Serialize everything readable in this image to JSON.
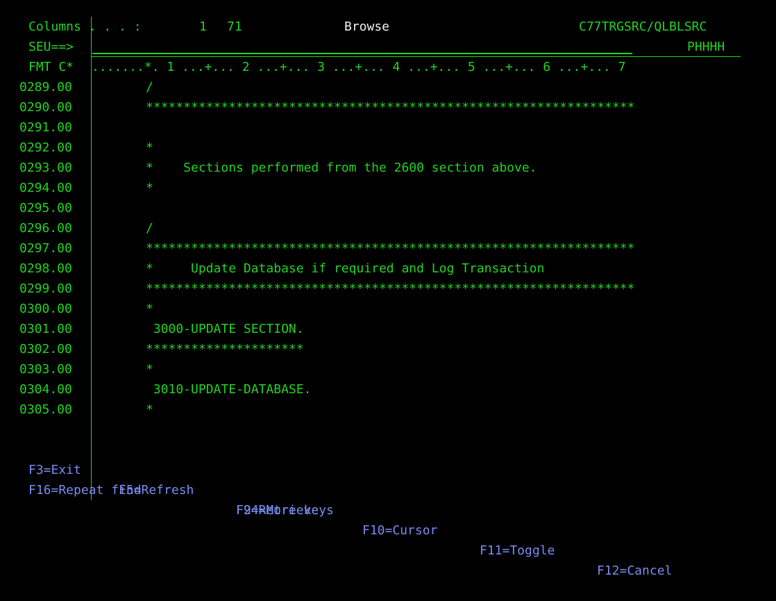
{
  "header": {
    "columns_label": "Columns . . . :",
    "columns_from": "1",
    "columns_to": "71",
    "mode": "Browse",
    "source_member": "C77TRGSRC/QLBLSRC",
    "command_prompt": "SEU==>",
    "command_value": "",
    "member_name": "PHHHH"
  },
  "ruler": {
    "prefix_label": "FMT C*",
    "scale": ".......*. 1 ...+... 2 ...+... 3 ...+... 4 ...+... 5 ...+... 6 ...+... 7"
  },
  "source_lines": [
    {
      "seq": "0289.00",
      "text": "/"
    },
    {
      "seq": "0290.00",
      "text": "*****************************************************************"
    },
    {
      "seq": "0291.00",
      "text": ""
    },
    {
      "seq": "0292.00",
      "text": "*"
    },
    {
      "seq": "0293.00",
      "text": "*    Sections performed from the 2600 section above."
    },
    {
      "seq": "0294.00",
      "text": "*"
    },
    {
      "seq": "0295.00",
      "text": ""
    },
    {
      "seq": "0296.00",
      "text": "/"
    },
    {
      "seq": "0297.00",
      "text": "*****************************************************************"
    },
    {
      "seq": "0298.00",
      "text": "*     Update Database if required and Log Transaction"
    },
    {
      "seq": "0299.00",
      "text": "*****************************************************************"
    },
    {
      "seq": "0300.00",
      "text": "*"
    },
    {
      "seq": "0301.00",
      "text": " 3000-UPDATE SECTION."
    },
    {
      "seq": "0302.00",
      "text": "*********************"
    },
    {
      "seq": "0303.00",
      "text": "*"
    },
    {
      "seq": "0304.00",
      "text": " 3010-UPDATE-DATABASE."
    },
    {
      "seq": "0305.00",
      "text": "*"
    }
  ],
  "function_keys": {
    "row1": [
      {
        "label": "F3=Exit"
      },
      {
        "label": "F5=Refresh"
      },
      {
        "label": "F9=Retrieve"
      },
      {
        "label": "F10=Cursor"
      },
      {
        "label": "F11=Toggle"
      },
      {
        "label": "F12=Cancel"
      }
    ],
    "row2": [
      {
        "label": "F16=Repeat find"
      },
      {
        "label": "F24=More keys"
      }
    ]
  },
  "colors": {
    "background": "#000000",
    "text_green": "#22d422",
    "title_white": "#f2f2f2",
    "fkey_blue": "#7b8cf0"
  }
}
